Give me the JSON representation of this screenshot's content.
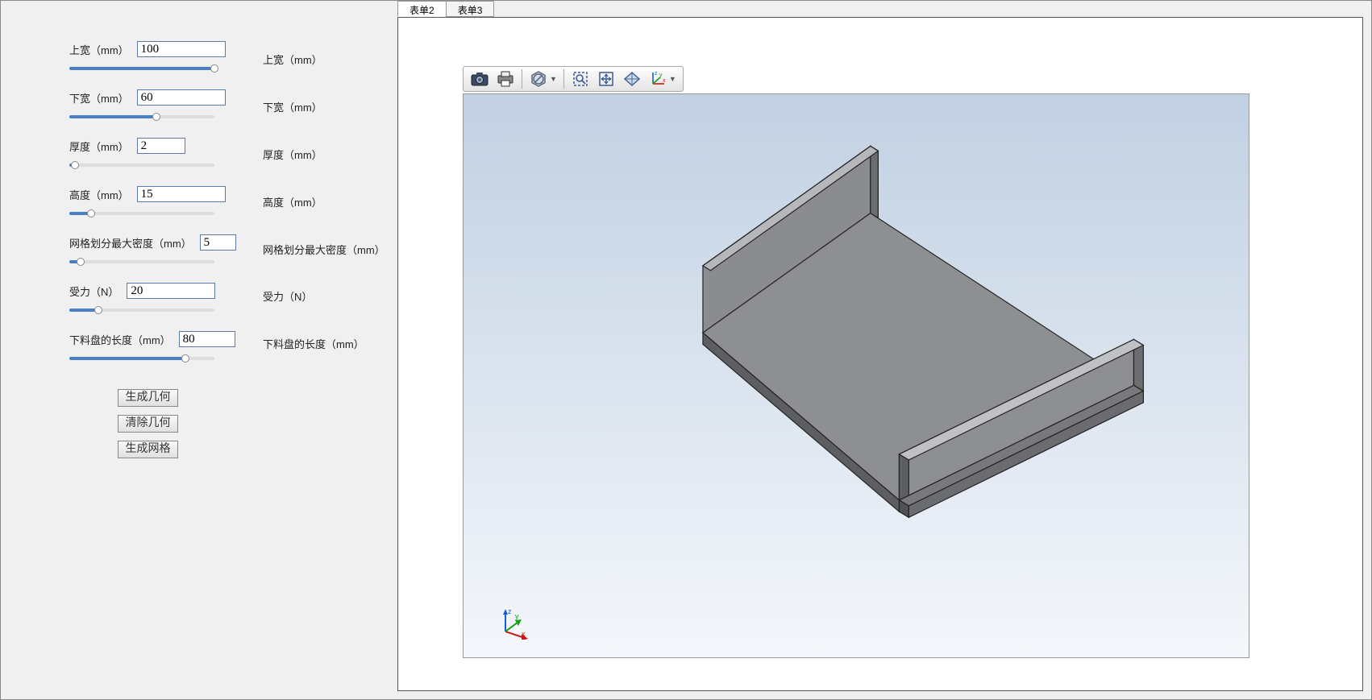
{
  "tabs": {
    "t2": "表单2",
    "t3": "表单3"
  },
  "params": {
    "upper_width": {
      "label": "上宽（mm）",
      "label2": "上宽（mm）",
      "value": "100",
      "pct": 100
    },
    "lower_width": {
      "label": "下宽（mm）",
      "label2": "下宽（mm）",
      "value": "60",
      "pct": 60
    },
    "thickness": {
      "label": "厚度（mm）",
      "label2": "厚度（mm）",
      "value": "2",
      "pct": 4
    },
    "height": {
      "label": "高度（mm）",
      "label2": "高度（mm）",
      "value": "15",
      "pct": 15
    },
    "mesh_density": {
      "label": "网格划分最大密度（mm）",
      "label2": "网格划分最大密度（mm）",
      "value": "5",
      "pct": 8
    },
    "force": {
      "label": "受力（N）",
      "label2": "受力（N）",
      "value": "20",
      "pct": 20
    },
    "length": {
      "label": "下料盘的长度（mm）",
      "label2": "下料盘的长度（mm）",
      "value": "80",
      "pct": 80
    }
  },
  "buttons": {
    "gen_geom": "生成几何",
    "clear_geom": "清除几何",
    "gen_mesh": "生成网格"
  },
  "toolbar_icons": {
    "camera": "camera-icon",
    "print": "print-icon",
    "nosel": "no-select-icon",
    "zoomwin": "zoom-window-icon",
    "fit": "zoom-fit-icon",
    "ortho": "ortho-icon",
    "axes": "axes-icon"
  }
}
